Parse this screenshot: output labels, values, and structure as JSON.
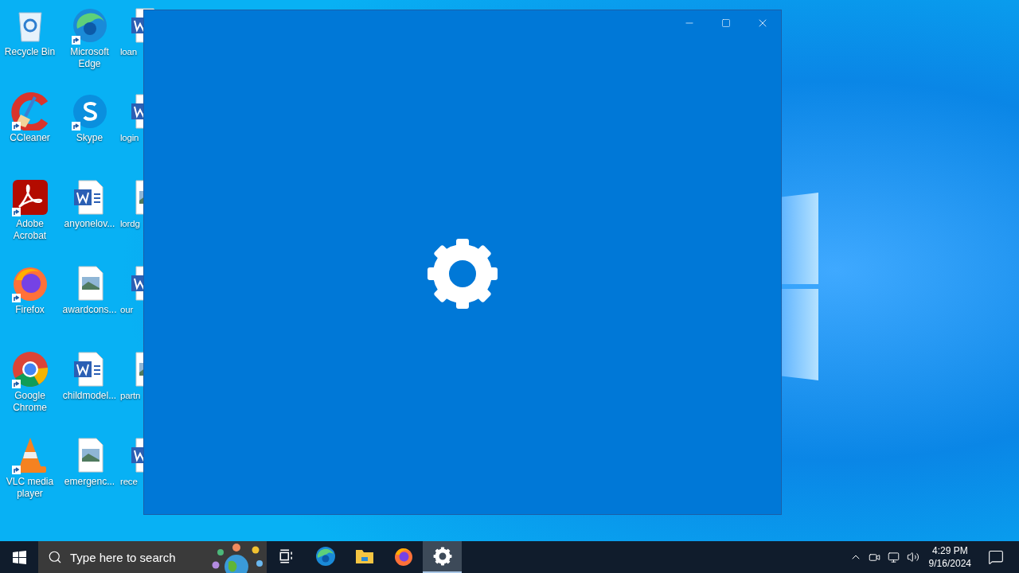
{
  "desktop": {
    "columns": [
      [
        {
          "label": "Recycle Bin",
          "kind": "recycle",
          "shortcut": false
        },
        {
          "label": "CCleaner",
          "kind": "ccleaner",
          "shortcut": true
        },
        {
          "label": "Adobe Acrobat",
          "kind": "acrobat",
          "shortcut": true
        },
        {
          "label": "Firefox",
          "kind": "firefox",
          "shortcut": true
        },
        {
          "label": "Google Chrome",
          "kind": "chrome",
          "shortcut": true
        },
        {
          "label": "VLC media player",
          "kind": "vlc",
          "shortcut": true
        }
      ],
      [
        {
          "label": "Microsoft Edge",
          "kind": "edge",
          "shortcut": true
        },
        {
          "label": "Skype",
          "kind": "skype",
          "shortcut": true
        },
        {
          "label": "anyonelov...",
          "kind": "word",
          "shortcut": false
        },
        {
          "label": "awardcons...",
          "kind": "image",
          "shortcut": false
        },
        {
          "label": "childmodel...",
          "kind": "word",
          "shortcut": false
        },
        {
          "label": "emergenc...",
          "kind": "image",
          "shortcut": false
        }
      ],
      [
        {
          "label": "loan",
          "kind": "word",
          "shortcut": false
        },
        {
          "label": "login",
          "kind": "word",
          "shortcut": false
        },
        {
          "label": "lordg",
          "kind": "image",
          "shortcut": false
        },
        {
          "label": "our",
          "kind": "word",
          "shortcut": false
        },
        {
          "label": "partn",
          "kind": "image",
          "shortcut": false
        },
        {
          "label": "rece",
          "kind": "word",
          "shortcut": false
        }
      ]
    ]
  },
  "window": {
    "kind": "splash"
  },
  "taskbar": {
    "search": {
      "placeholder": "Type here to search"
    },
    "apps": [
      {
        "kind": "taskview",
        "selected": false
      },
      {
        "kind": "edge",
        "selected": false
      },
      {
        "kind": "explorer",
        "selected": false
      },
      {
        "kind": "firefox",
        "selected": false
      },
      {
        "kind": "settings",
        "selected": true
      }
    ],
    "clock": {
      "time": "4:29 PM",
      "date": "9/16/2024"
    }
  }
}
